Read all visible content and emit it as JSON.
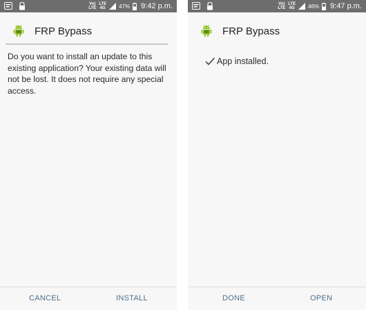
{
  "left_screen": {
    "status": {
      "network_1": "Vo) LTE",
      "network_2": "LTE 4G",
      "battery": "47%",
      "time": "9:42 p.m."
    },
    "app_name": "FRP Bypass",
    "message": "Do you want to install an update to this existing application? Your existing data will not be lost. It does not require any special access.",
    "buttons": {
      "cancel": "CANCEL",
      "install": "INSTALL"
    }
  },
  "right_screen": {
    "status": {
      "network_1": "Vo) LTE",
      "network_2": "LTE 4G",
      "battery": "46%",
      "time": "9:47 p.m."
    },
    "app_name": "FRP Bypass",
    "installed_message": "App installed.",
    "buttons": {
      "done": "DONE",
      "open": "OPEN"
    }
  },
  "colors": {
    "statusbar": "#6d6d6d",
    "background": "#f7f7f7",
    "button_text": "#4a6f8c",
    "android_green": "#8ec21f"
  },
  "icons": [
    "notification-icon",
    "secure-icon",
    "signal-icon",
    "android-icon",
    "check-icon"
  ]
}
